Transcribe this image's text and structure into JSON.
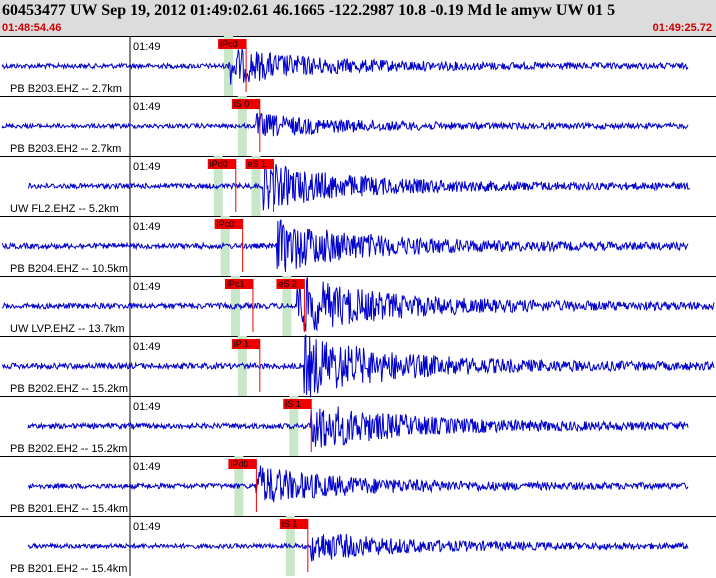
{
  "header": {
    "title": "60453477 UW Sep 19, 2012 01:49:02.61   46.1665 -122.2987 10.8 -0.19 Md le amyw UW 01   5",
    "start_time": "01:48:54.46",
    "end_time": "01:49:25.72"
  },
  "colors": {
    "trace": "#0000cc",
    "pick_box": "#ee0000",
    "pick_window": "#c8e6c8",
    "time_text": "#d00000",
    "header_bg": "#dcdcdc"
  },
  "traces": [
    {
      "label": "PB B203.EHZ -- 2.7km",
      "time_tick": "01:49",
      "amplitude": 0.55,
      "arrival": 0.33,
      "picks": [
        {
          "label": "iPc0",
          "pos": 0.315
        }
      ]
    },
    {
      "label": "PB B203.EH2 -- 2.7km",
      "time_tick": "01:49",
      "amplitude": 0.35,
      "arrival": 0.37,
      "picks": [
        {
          "label": "iS 0",
          "pos": 0.335
        }
      ]
    },
    {
      "label": "UW FL2.EHZ -- 5.2km",
      "time_tick": "01:49",
      "amplitude": 0.7,
      "arrival": 0.38,
      "picks": [
        {
          "label": "iPd0",
          "pos": 0.3
        },
        {
          "label": "eS 1",
          "pos": 0.355
        }
      ]
    },
    {
      "label": "PB B204.EHZ -- 10.5km",
      "time_tick": "01:49",
      "amplitude": 0.8,
      "arrival": 0.4,
      "picks": [
        {
          "label": "iPc0",
          "pos": 0.31
        }
      ]
    },
    {
      "label": "UW LVP.EHZ -- 13.7km",
      "time_tick": "01:49",
      "amplitude": 0.9,
      "arrival": 0.43,
      "picks": [
        {
          "label": "iPc1",
          "pos": 0.325
        },
        {
          "label": "eS 2",
          "pos": 0.4
        }
      ]
    },
    {
      "label": "PB B202.EHZ -- 15.2km",
      "time_tick": "01:49",
      "amplitude": 0.95,
      "arrival": 0.44,
      "picks": [
        {
          "label": "iP 1",
          "pos": 0.335
        }
      ]
    },
    {
      "label": "PB B202.EH2 -- 15.2km",
      "time_tick": "01:49",
      "amplitude": 0.75,
      "arrival": 0.45,
      "picks": [
        {
          "label": "iS 1",
          "pos": 0.41
        }
      ]
    },
    {
      "label": "PB B201.EHZ -- 15.4km",
      "time_tick": "01:49",
      "amplitude": 0.6,
      "arrival": 0.37,
      "picks": [
        {
          "label": "iPd0",
          "pos": 0.33
        }
      ]
    },
    {
      "label": "PB B201.EH2 -- 15.4km",
      "time_tick": "01:49",
      "amplitude": 0.45,
      "arrival": 0.45,
      "picks": [
        {
          "label": "iS 1",
          "pos": 0.405
        }
      ]
    }
  ]
}
